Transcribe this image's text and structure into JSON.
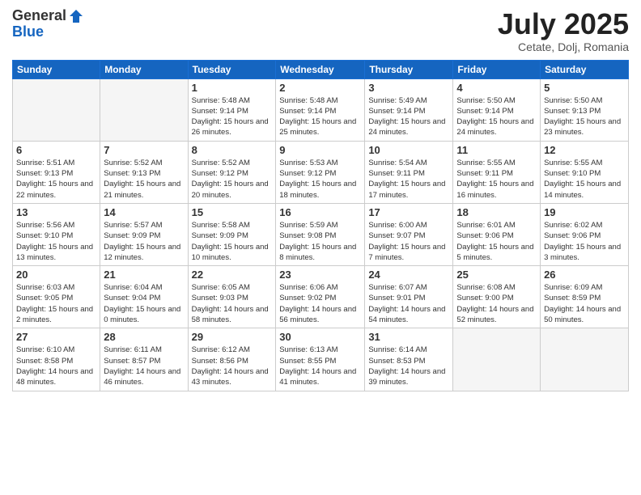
{
  "logo": {
    "general": "General",
    "blue": "Blue"
  },
  "title": "July 2025",
  "subtitle": "Cetate, Dolj, Romania",
  "days_header": [
    "Sunday",
    "Monday",
    "Tuesday",
    "Wednesday",
    "Thursday",
    "Friday",
    "Saturday"
  ],
  "weeks": [
    [
      {
        "day": "",
        "info": ""
      },
      {
        "day": "",
        "info": ""
      },
      {
        "day": "1",
        "info": "Sunrise: 5:48 AM\nSunset: 9:14 PM\nDaylight: 15 hours\nand 26 minutes."
      },
      {
        "day": "2",
        "info": "Sunrise: 5:48 AM\nSunset: 9:14 PM\nDaylight: 15 hours\nand 25 minutes."
      },
      {
        "day": "3",
        "info": "Sunrise: 5:49 AM\nSunset: 9:14 PM\nDaylight: 15 hours\nand 24 minutes."
      },
      {
        "day": "4",
        "info": "Sunrise: 5:50 AM\nSunset: 9:14 PM\nDaylight: 15 hours\nand 24 minutes."
      },
      {
        "day": "5",
        "info": "Sunrise: 5:50 AM\nSunset: 9:13 PM\nDaylight: 15 hours\nand 23 minutes."
      }
    ],
    [
      {
        "day": "6",
        "info": "Sunrise: 5:51 AM\nSunset: 9:13 PM\nDaylight: 15 hours\nand 22 minutes."
      },
      {
        "day": "7",
        "info": "Sunrise: 5:52 AM\nSunset: 9:13 PM\nDaylight: 15 hours\nand 21 minutes."
      },
      {
        "day": "8",
        "info": "Sunrise: 5:52 AM\nSunset: 9:12 PM\nDaylight: 15 hours\nand 20 minutes."
      },
      {
        "day": "9",
        "info": "Sunrise: 5:53 AM\nSunset: 9:12 PM\nDaylight: 15 hours\nand 18 minutes."
      },
      {
        "day": "10",
        "info": "Sunrise: 5:54 AM\nSunset: 9:11 PM\nDaylight: 15 hours\nand 17 minutes."
      },
      {
        "day": "11",
        "info": "Sunrise: 5:55 AM\nSunset: 9:11 PM\nDaylight: 15 hours\nand 16 minutes."
      },
      {
        "day": "12",
        "info": "Sunrise: 5:55 AM\nSunset: 9:10 PM\nDaylight: 15 hours\nand 14 minutes."
      }
    ],
    [
      {
        "day": "13",
        "info": "Sunrise: 5:56 AM\nSunset: 9:10 PM\nDaylight: 15 hours\nand 13 minutes."
      },
      {
        "day": "14",
        "info": "Sunrise: 5:57 AM\nSunset: 9:09 PM\nDaylight: 15 hours\nand 12 minutes."
      },
      {
        "day": "15",
        "info": "Sunrise: 5:58 AM\nSunset: 9:09 PM\nDaylight: 15 hours\nand 10 minutes."
      },
      {
        "day": "16",
        "info": "Sunrise: 5:59 AM\nSunset: 9:08 PM\nDaylight: 15 hours\nand 8 minutes."
      },
      {
        "day": "17",
        "info": "Sunrise: 6:00 AM\nSunset: 9:07 PM\nDaylight: 15 hours\nand 7 minutes."
      },
      {
        "day": "18",
        "info": "Sunrise: 6:01 AM\nSunset: 9:06 PM\nDaylight: 15 hours\nand 5 minutes."
      },
      {
        "day": "19",
        "info": "Sunrise: 6:02 AM\nSunset: 9:06 PM\nDaylight: 15 hours\nand 3 minutes."
      }
    ],
    [
      {
        "day": "20",
        "info": "Sunrise: 6:03 AM\nSunset: 9:05 PM\nDaylight: 15 hours\nand 2 minutes."
      },
      {
        "day": "21",
        "info": "Sunrise: 6:04 AM\nSunset: 9:04 PM\nDaylight: 15 hours\nand 0 minutes."
      },
      {
        "day": "22",
        "info": "Sunrise: 6:05 AM\nSunset: 9:03 PM\nDaylight: 14 hours\nand 58 minutes."
      },
      {
        "day": "23",
        "info": "Sunrise: 6:06 AM\nSunset: 9:02 PM\nDaylight: 14 hours\nand 56 minutes."
      },
      {
        "day": "24",
        "info": "Sunrise: 6:07 AM\nSunset: 9:01 PM\nDaylight: 14 hours\nand 54 minutes."
      },
      {
        "day": "25",
        "info": "Sunrise: 6:08 AM\nSunset: 9:00 PM\nDaylight: 14 hours\nand 52 minutes."
      },
      {
        "day": "26",
        "info": "Sunrise: 6:09 AM\nSunset: 8:59 PM\nDaylight: 14 hours\nand 50 minutes."
      }
    ],
    [
      {
        "day": "27",
        "info": "Sunrise: 6:10 AM\nSunset: 8:58 PM\nDaylight: 14 hours\nand 48 minutes."
      },
      {
        "day": "28",
        "info": "Sunrise: 6:11 AM\nSunset: 8:57 PM\nDaylight: 14 hours\nand 46 minutes."
      },
      {
        "day": "29",
        "info": "Sunrise: 6:12 AM\nSunset: 8:56 PM\nDaylight: 14 hours\nand 43 minutes."
      },
      {
        "day": "30",
        "info": "Sunrise: 6:13 AM\nSunset: 8:55 PM\nDaylight: 14 hours\nand 41 minutes."
      },
      {
        "day": "31",
        "info": "Sunrise: 6:14 AM\nSunset: 8:53 PM\nDaylight: 14 hours\nand 39 minutes."
      },
      {
        "day": "",
        "info": ""
      },
      {
        "day": "",
        "info": ""
      }
    ]
  ]
}
